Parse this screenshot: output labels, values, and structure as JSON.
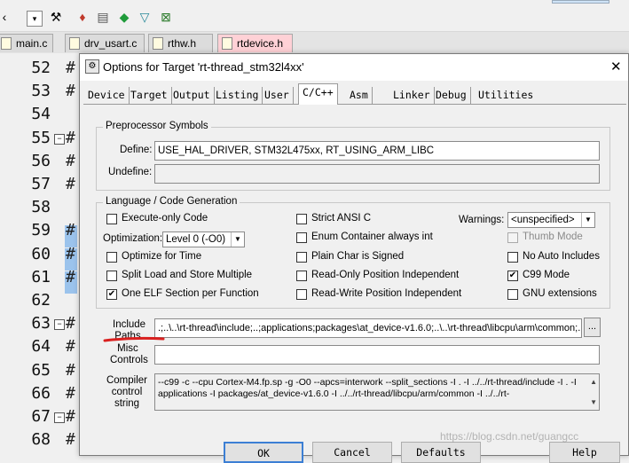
{
  "toolbar": {
    "icons": [
      "chevron-icon",
      "dropdown-icon",
      "magic-wand-icon",
      "build-icon",
      "translate-icon",
      "download-icon",
      "options-icon",
      "manage-icon"
    ]
  },
  "file_tabs": [
    {
      "label": "main.c",
      "active": false
    },
    {
      "label": "drv_usart.c",
      "active": false
    },
    {
      "label": "rthw.h",
      "active": false
    },
    {
      "label": "rtdevice.h",
      "active": true
    }
  ],
  "gutter": {
    "lines": [
      "52",
      "53",
      "54",
      "55",
      "56",
      "57",
      "58",
      "59",
      "60",
      "61",
      "62",
      "63",
      "64",
      "65",
      "66",
      "67",
      "68"
    ],
    "hash": "#"
  },
  "dialog": {
    "title": "Options for Target 'rt-thread_stm32l4xx'",
    "close": "✕",
    "tabs": [
      "Device",
      "Target",
      "Output",
      "Listing",
      "User",
      "C/C++",
      "Asm",
      "Linker",
      "Debug",
      "Utilities"
    ],
    "selected_tab": "C/C++",
    "preprocessor": {
      "group_label": "Preprocessor Symbols",
      "define_label": "Define:",
      "define_value": "USE_HAL_DRIVER, STM32L475xx, RT_USING_ARM_LIBC",
      "undefine_label": "Undefine:",
      "undefine_value": ""
    },
    "language": {
      "group_label": "Language / Code Generation",
      "execute_only": "Execute-only Code",
      "optimization_label": "Optimization:",
      "optimization_value": "Level 0 (-O0)",
      "optimize_time": "Optimize for Time",
      "split_load": "Split Load and Store Multiple",
      "one_elf": "One ELF Section per Function",
      "strict_ansi": "Strict ANSI C",
      "enum_container": "Enum Container always int",
      "plain_char": "Plain Char is Signed",
      "ro_position": "Read-Only Position Independent",
      "rw_position": "Read-Write Position Independent",
      "warnings_label": "Warnings:",
      "warnings_value": "<unspecified>",
      "thumb_mode": "Thumb Mode",
      "no_auto_includes": "No Auto Includes",
      "c99_mode": "C99 Mode",
      "gnu_extensions": "GNU extensions",
      "checked": {
        "one_elf": true,
        "c99_mode": true
      }
    },
    "include_paths": {
      "label_line1": "Include",
      "label_line2": "Paths",
      "value": ".;..\\..\\rt-thread\\include;..;applications;packages\\at_device-v1.6.0;..\\..\\rt-thread\\libcpu\\arm\\common;..",
      "browse": "..."
    },
    "misc_controls": {
      "label_line1": "Misc",
      "label_line2": "Controls",
      "value": ""
    },
    "compiler_control": {
      "label_line1": "Compiler",
      "label_line2": "control",
      "label_line3": "string",
      "line1": "--c99 -c --cpu Cortex-M4.fp.sp -g -O0 --apcs=interwork --split_sections -I . -I ../../rt-thread/include -I . -I",
      "line2": "applications -I packages/at_device-v1.6.0 -I ../../rt-thread/libcpu/arm/common -I ../../rt-"
    },
    "buttons": {
      "ok": "OK",
      "cancel": "Cancel",
      "defaults": "Defaults",
      "help": "Help"
    }
  },
  "watermark": "https://blog.csdn.net/guangcc",
  "colors": {
    "annotation_red": "#d9201f",
    "active_tab": "#ffd1d6",
    "highlight": "#9bc3ec"
  }
}
